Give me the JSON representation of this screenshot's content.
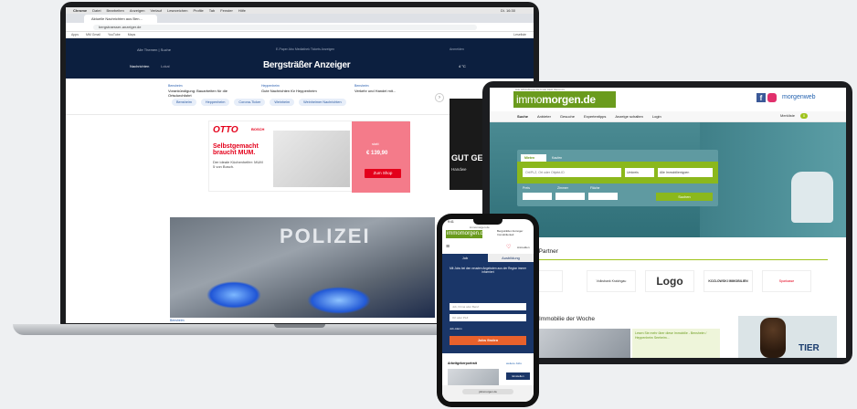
{
  "laptop": {
    "mac_menu": [
      "Chrome",
      "Datei",
      "Bearbeiten",
      "Anzeigen",
      "Verlauf",
      "Lesezeichen",
      "Profile",
      "Tab",
      "Fenster",
      "Hilfe"
    ],
    "mac_right": "Di. 16:30",
    "tab_title": "Aktuelle Nachrichten aus Ben...",
    "url": "bergstraesser-anzeiger.de",
    "bookmarks": [
      "Apps",
      "MM Gmail",
      "YouTube",
      "Maps"
    ],
    "bookmarks_right": "Leseliste",
    "header": {
      "top_left": "Alle Themen  |  Suche",
      "nav2": "E-Paper  Abo  Mediathek  Tickets  Anzeigen",
      "top_right": "Anmelden",
      "logo": "Bergsträßer Anzeiger",
      "tab_active": "Nachrichten",
      "tab_2": "Lokal",
      "weather": "4 °C"
    },
    "ticker": [
      {
        "cat": "Bensheim",
        "title": "Vorankündigung: Bauarbeiten für die Ortsdurchfahrt"
      },
      {
        "cat": "Heppenheim",
        "title": "Gute Nachrichten für Heppenheim"
      },
      {
        "cat": "Bensheim",
        "title": "Verkehr und Handel mit..."
      }
    ],
    "chips": [
      "Bensheim",
      "Heppenheim",
      "Corona-Ticker",
      "Weinheim",
      "Weinheimer Nachrichten"
    ],
    "ad": {
      "brand": "OTTO",
      "partner": "BOSCH",
      "headline": "Selbstgemacht braucht MUM.",
      "sub": "Der ideale Küchenhelfer: MUM 5 von Bosch.",
      "price_label": "statt",
      "price": "€ 139,90",
      "cta": "Zum Shop"
    },
    "side_ad": {
      "title": "GUT GE",
      "sub": "Handwe"
    },
    "hero_word": "POLIZEI",
    "hero_kicker": "Bensheim"
  },
  "tablet": {
    "top_text": "DIE IMMOBILIENSUCHE DER REGION",
    "logo_a": "immo",
    "logo_b": "morgen.de",
    "morgenweb": "morgenweb",
    "nav": [
      "Suche",
      "Anbieter",
      "Gesuche",
      "Expertentipps",
      "Anzeige schalten",
      "Login"
    ],
    "merkliste": "Merkliste",
    "merkliste_count": "0",
    "search": {
      "tab_1": "Mieten",
      "tab_2": "Kaufen",
      "placeholder": "Ort/PLZ, Ort oder Objekt-ID",
      "radius": "Umkreis",
      "type": "Alle Immobilientypen",
      "label_price": "Preis",
      "label_rooms": "Zimmer",
      "label_area": "Fläche",
      "button": "Suchen"
    },
    "partners_title": "Immobilien-Partner",
    "partner_logos": [
      "",
      "Volksbank Kraichgau",
      "Logo",
      "KOZLOWSKI IMMOBILIEN",
      "Sparkasse"
    ],
    "woche_title": "Immobilie der Woche",
    "woche_text": "Lesen Sie mehr über diese Immobilie - Bensheim / Heppenheim Seeheim...",
    "dog_ad": "TIER"
  },
  "phone": {
    "time": "9:41",
    "url": "immomorgen.de",
    "logo": "immomorgen.de",
    "ad_text": "Bergsträßer Anzeiger Immobilienteil",
    "login": "Anmelden",
    "tab_1": "Job",
    "tab_2": "Ausbildung",
    "blue_text": "Mit Jobs bei den neusten Angeboten aus der Region immer informiert",
    "input_1": "Job, Firma oder Beruf",
    "input_2": "Ort oder PLZ",
    "checkbox": "Job-Alarm",
    "button": "Jobs finden",
    "section": "Arbeitgeberportrait",
    "section_link": "weitere Jobs",
    "einstellen": "Einstellen",
    "bottom_url": "jobsmorgen.de"
  }
}
